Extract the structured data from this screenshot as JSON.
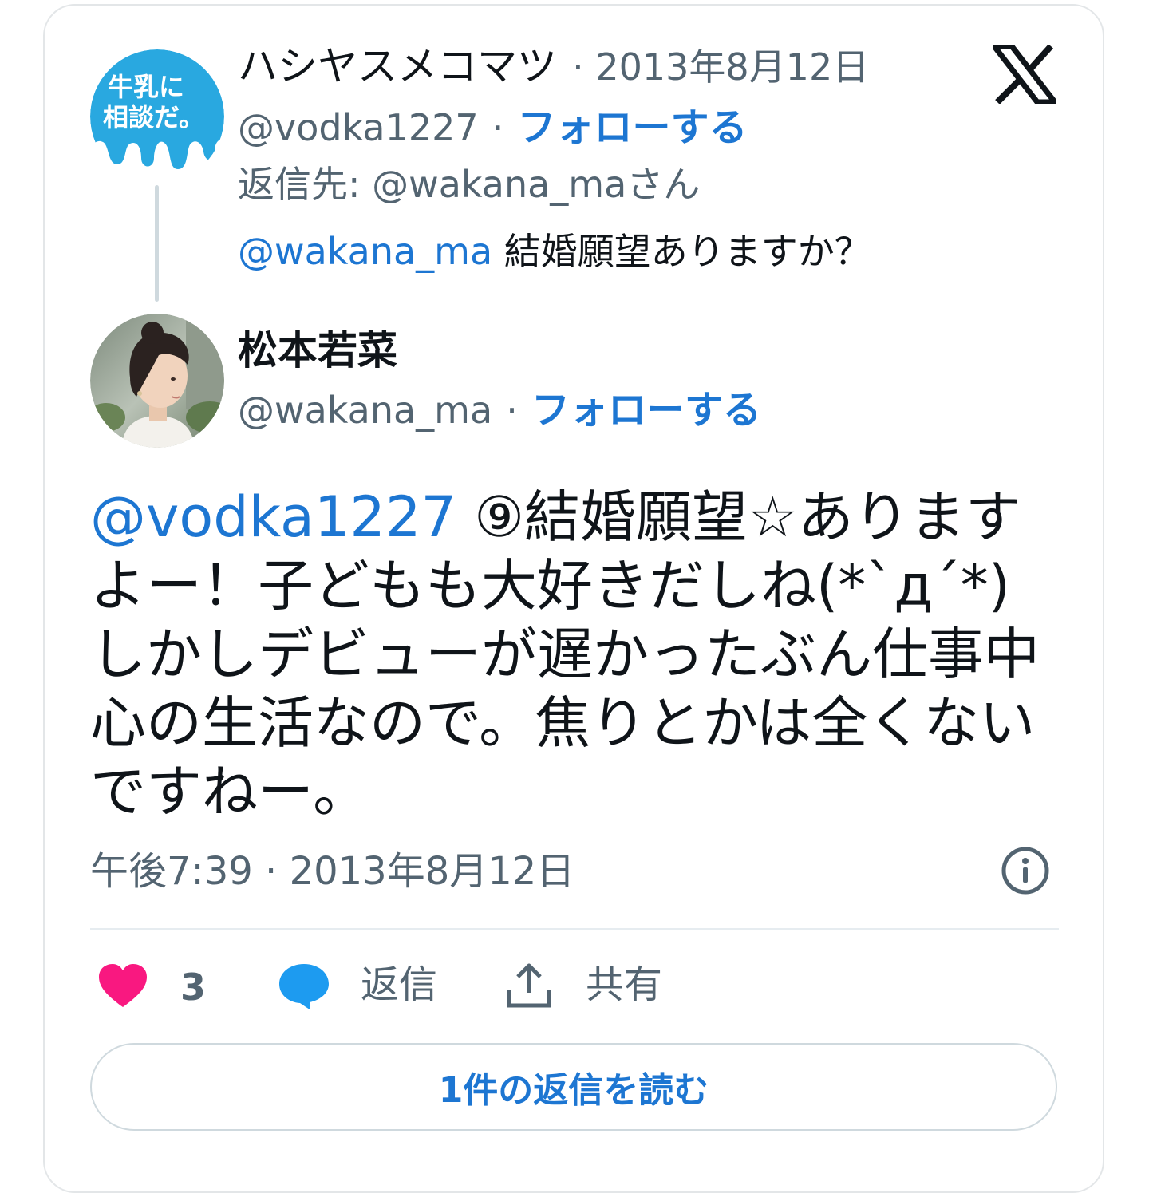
{
  "parent_tweet": {
    "avatar_text_line1": "牛乳に",
    "avatar_text_line2": "相談だ。",
    "display_name": "ハシヤスメコマツ",
    "date": "· 2013年8月12日",
    "handle": "@vodka1227",
    "handle_sep": "·",
    "follow_label": "フォローする",
    "reply_to_prefix": "返信先: ",
    "reply_to_handle": "@wakana_ma",
    "reply_to_suffix": "さん",
    "text_mention": "@wakana_ma",
    "text_body": " 結婚願望ありますか？"
  },
  "main_tweet": {
    "display_name": "松本若菜",
    "handle": "@wakana_ma",
    "handle_sep": "·",
    "follow_label": "フォローする",
    "text_mention": "@vodka1227",
    "text_body": " ⑨結婚願望☆ありますよー！子どもも大好きだしね(*`д´*) しかしデビューが遅かったぶん仕事中心の生活なので。焦りとかは全くないですねー。",
    "timestamp": "午後7:39 · 2013年8月12日"
  },
  "actions": {
    "like_count": "3",
    "reply_label": "返信",
    "share_label": "共有"
  },
  "read_replies_label": "1件の返信を読む",
  "colors": {
    "link": "#1d76d2",
    "heart": "#f91880",
    "reply_bubble": "#1d9bf0",
    "milk_blue": "#29a8e0",
    "secondary_text": "#536471"
  }
}
